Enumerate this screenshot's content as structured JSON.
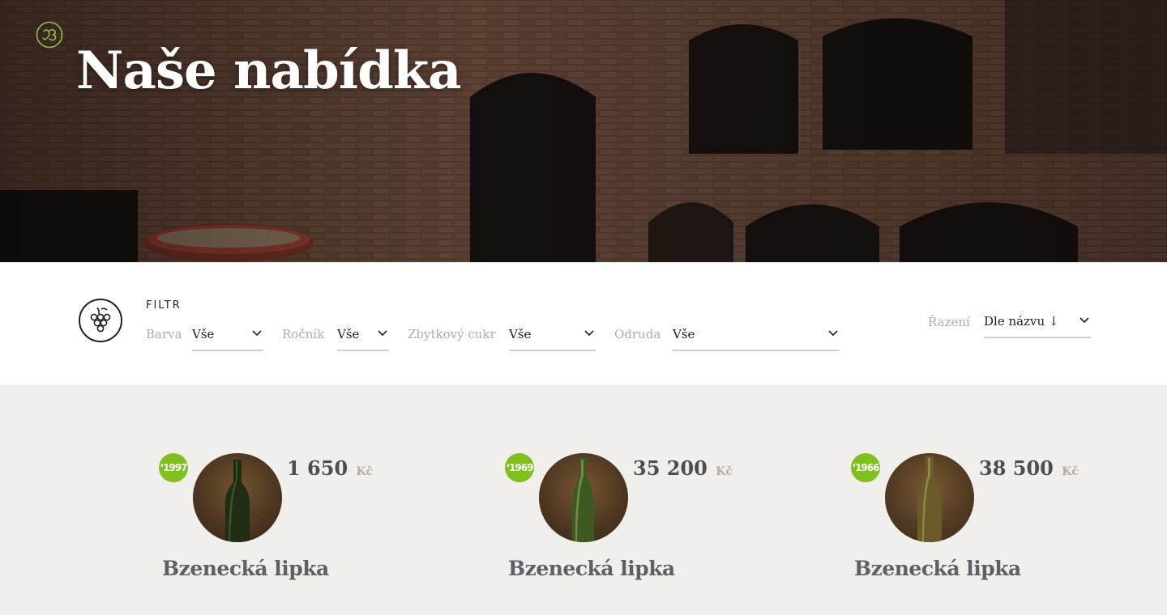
{
  "hero": {
    "title": "Naše nabídka"
  },
  "filter": {
    "title": "FILTR",
    "fields": [
      {
        "label": "Barva",
        "value": "Vše"
      },
      {
        "label": "Ročník",
        "value": "Vše"
      },
      {
        "label": "Zbytkový cukr",
        "value": "Vše"
      },
      {
        "label": "Odruda",
        "value": "Vše"
      }
    ],
    "sort": {
      "label": "Řazení",
      "value": "Dle názvu ↓"
    }
  },
  "products": [
    {
      "year": "‘1997",
      "price": "1 650",
      "currency": "Kč",
      "name": "Bzenecká lipka"
    },
    {
      "year": "‘1969",
      "price": "35 200",
      "currency": "Kč",
      "name": "Bzenecká lipka"
    },
    {
      "year": "‘1966",
      "price": "38 500",
      "currency": "Kč",
      "name": "Bzenecká lipka"
    }
  ],
  "colors": {
    "accent_green": "#7fbf1e",
    "muted_label": "#b5aca4",
    "text_dark": "#4b4e55",
    "page_bg": "#f0efeb"
  },
  "icons": {
    "logo": "monogram-logo-icon",
    "filter": "grape-cluster-icon",
    "dropdown": "chevron-down-icon"
  }
}
